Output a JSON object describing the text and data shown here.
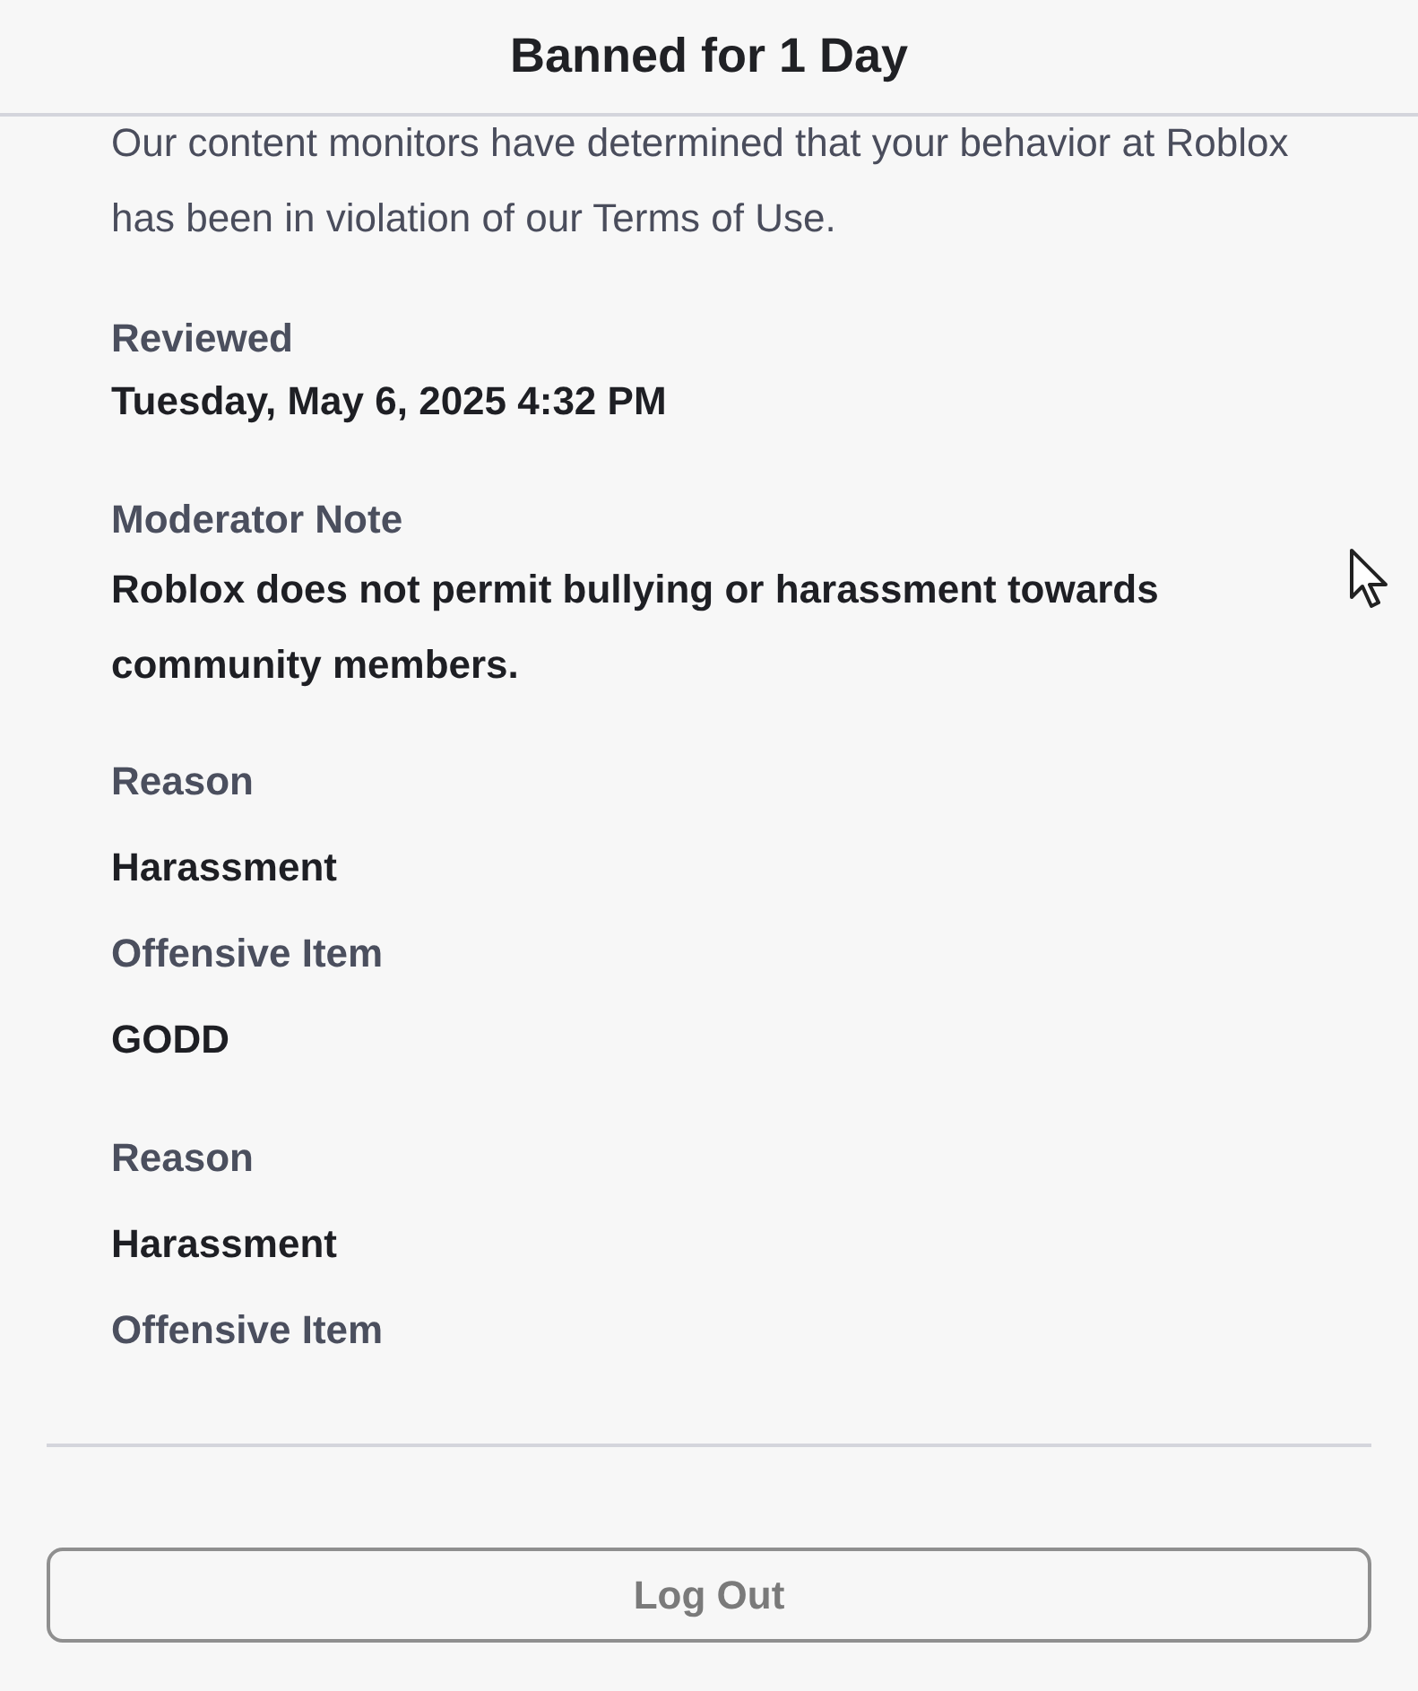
{
  "header": {
    "title": "Banned for 1 Day"
  },
  "intro": "Our content monitors have determined that your behavior at Roblox has been in violation of our Terms of Use.",
  "reviewed": {
    "label": "Reviewed",
    "value": "Tuesday, May 6, 2025 4:32 PM"
  },
  "moderator_note": {
    "label": "Moderator Note",
    "value": "Roblox does not permit bullying or harassment towards community members."
  },
  "violations": [
    {
      "reason_label": "Reason",
      "reason": "Harassment",
      "item_label": "Offensive Item",
      "item": "GODD"
    },
    {
      "reason_label": "Reason",
      "reason": "Harassment",
      "item_label": "Offensive Item"
    }
  ],
  "logout_button": "Log Out"
}
